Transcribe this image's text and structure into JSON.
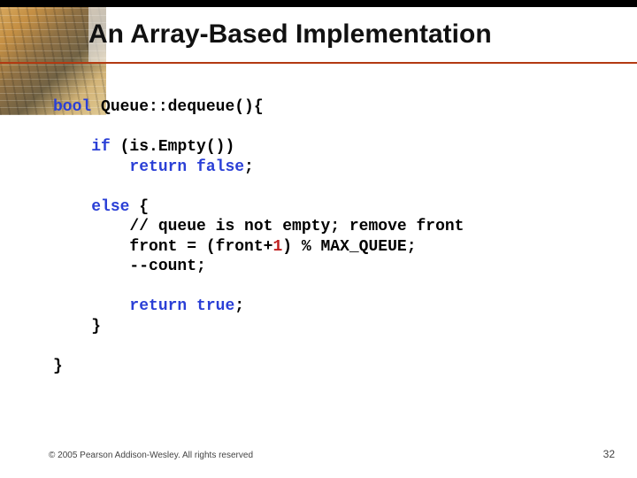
{
  "title": "An Array-Based Implementation",
  "code": {
    "sig_kw": "bool",
    "sig_rest": " Queue::dequeue(){",
    "if_kw": "if",
    "if_cond": " (is.Empty())",
    "ret1_kw": "return",
    "ret1_val": " false",
    "semi": ";",
    "else_kw": "else",
    "else_open": " {",
    "comment": "// queue is not empty; remove front",
    "assign_pre": "front = (front+",
    "one": "1",
    "assign_post": ") % MAX_QUEUE;",
    "decr": "--count;",
    "ret2_kw": "return",
    "ret2_val": " true",
    "close_inner": "}",
    "close_outer": "}"
  },
  "copyright": "© 2005 Pearson Addison-Wesley. All rights reserved",
  "page": "32"
}
